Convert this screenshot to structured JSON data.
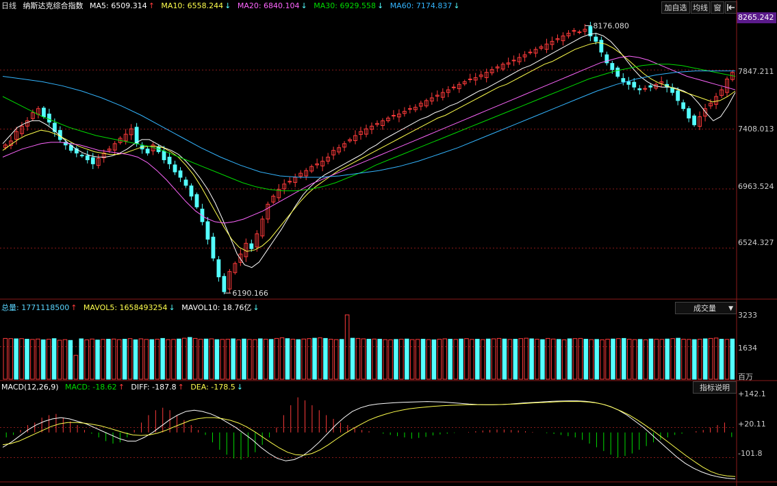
{
  "colors": {
    "up": "#ff3b3b",
    "down": "#54ffff",
    "ma5": "#ffffff",
    "ma10": "#ffff4d",
    "ma20": "#ff66ff",
    "ma30": "#00dd00",
    "ma60": "#33b5ff",
    "grid": "#8b1a1a",
    "axis_box": "#5a1a8a"
  },
  "price_header": {
    "period": "日线",
    "index_name": "纳斯达克综合指数",
    "ma5": "MA5: 6509.314",
    "ma5_arrow": "↑",
    "ma10": "MA10: 6558.244",
    "ma10_arrow": "↓",
    "ma20": "MA20: 6840.104",
    "ma20_arrow": "↓",
    "ma30": "MA30: 6929.558",
    "ma30_arrow": "↓",
    "ma60": "MA60: 7174.837",
    "ma60_arrow": "↓"
  },
  "toolbar": {
    "add_watch": "加自选",
    "avg_line": "均线",
    "window": "窗",
    "exit_icon": "exit-icon"
  },
  "volume_header": {
    "total": "总量: 1771118500",
    "total_arrow": "↑",
    "mavol5": "MAVOL5: 1658493254",
    "mavol5_arrow": "↓",
    "mavol10": "MAVOL10: 18.76亿",
    "mavol10_arrow": "↓",
    "dropdown_label": "成交量",
    "dropdown_icon": "triangle-down-icon"
  },
  "macd_header": {
    "params": "MACD(12,26,9)",
    "macd": "MACD: -18.62",
    "macd_arrow": "↑",
    "diff": "DIFF: -187.8",
    "diff_arrow": "↑",
    "dea": "DEA: -178.5",
    "dea_arrow": "↓",
    "help_button": "指标说明"
  },
  "price_axis": {
    "top_box": "8265.242",
    "labels": [
      "7847.211",
      "7408.013",
      "6963.524",
      "6524.327"
    ]
  },
  "volume_axis": {
    "labels": [
      "3233",
      "1634"
    ],
    "unit": "百万"
  },
  "macd_axis": {
    "labels": [
      "+142.1",
      "+20.11",
      "-101.8"
    ]
  },
  "chart_data": [
    {
      "type": "candlestick",
      "title": "纳斯达克综合指数",
      "annotations": [
        {
          "label": "8176.080",
          "value": 8176.08,
          "kind": "high"
        },
        {
          "label": "6190.166",
          "value": 6190.166,
          "kind": "low"
        }
      ],
      "ylim": [
        6150,
        8265.242
      ],
      "yticks": [
        7847.211,
        7408.013,
        6963.524,
        6524.327
      ],
      "close": [
        7290,
        7320,
        7390,
        7430,
        7470,
        7530,
        7560,
        7500,
        7460,
        7390,
        7330,
        7290,
        7250,
        7230,
        7210,
        7180,
        7150,
        7190,
        7230,
        7260,
        7300,
        7340,
        7370,
        7410,
        7300,
        7260,
        7230,
        7290,
        7240,
        7180,
        7150,
        7090,
        7050,
        6990,
        6910,
        6830,
        6720,
        6590,
        6450,
        6310,
        6200,
        6350,
        6410,
        6480,
        6560,
        6520,
        6630,
        6740,
        6850,
        6910,
        6960,
        7000,
        7020,
        7050,
        7080,
        7100,
        7130,
        7150,
        7170,
        7200,
        7250,
        7270,
        7300,
        7330,
        7360,
        7390,
        7410,
        7430,
        7450,
        7470,
        7490,
        7510,
        7520,
        7540,
        7560,
        7570,
        7600,
        7620,
        7640,
        7660,
        7680,
        7700,
        7720,
        7740,
        7760,
        7780,
        7790,
        7810,
        7830,
        7850,
        7870,
        7890,
        7900,
        7920,
        7940,
        7960,
        7980,
        8000,
        8020,
        8040,
        8060,
        8080,
        8100,
        8120,
        8140,
        8130,
        8150,
        8100,
        8060,
        7980,
        7900,
        7850,
        7800,
        7760,
        7740,
        7720,
        7700,
        7710,
        7720,
        7740,
        7760,
        7720,
        7680,
        7620,
        7560,
        7490,
        7440,
        7500,
        7560,
        7600,
        7650,
        7700,
        7780,
        7830
      ]
    },
    {
      "type": "line",
      "series": [
        {
          "name": "MA5",
          "values": [
            7300,
            7360,
            7420,
            7450,
            7470,
            7470,
            7440,
            7400,
            7350,
            7300,
            7260,
            7230,
            7210,
            7200,
            7200,
            7210,
            7230,
            7260,
            7300,
            7330,
            7330,
            7300,
            7270,
            7250,
            7220,
            7170,
            7110,
            7040,
            6960,
            6860,
            6740,
            6610,
            6480,
            6400,
            6380,
            6420,
            6500,
            6580,
            6660,
            6750,
            6840,
            6920,
            6980,
            7030,
            7070,
            7100,
            7130,
            7160,
            7190,
            7220,
            7260,
            7290,
            7330,
            7360,
            7390,
            7420,
            7450,
            7480,
            7500,
            7530,
            7550,
            7580,
            7600,
            7630,
            7660,
            7690,
            7710,
            7740,
            7770,
            7800,
            7830,
            7860,
            7880,
            7910,
            7940,
            7970,
            8000,
            8030,
            8060,
            8090,
            8110,
            8120,
            8100,
            8060,
            8000,
            7930,
            7860,
            7800,
            7760,
            7730,
            7720,
            7720,
            7710,
            7690,
            7660,
            7600,
            7530,
            7470,
            7500,
            7580,
            7680
          ]
        },
        {
          "name": "MA10",
          "values": [
            7250,
            7290,
            7330,
            7360,
            7380,
            7400,
            7390,
            7370,
            7340,
            7310,
            7280,
            7260,
            7240,
            7230,
            7220,
            7220,
            7230,
            7250,
            7270,
            7280,
            7280,
            7270,
            7240,
            7200,
            7140,
            7070,
            6980,
            6880,
            6780,
            6680,
            6590,
            6530,
            6500,
            6510,
            6540,
            6590,
            6660,
            6730,
            6800,
            6870,
            6930,
            6980,
            7020,
            7060,
            7100,
            7130,
            7160,
            7190,
            7220,
            7250,
            7280,
            7310,
            7340,
            7370,
            7400,
            7430,
            7460,
            7490,
            7510,
            7540,
            7570,
            7600,
            7630,
            7660,
            7690,
            7720,
            7740,
            7770,
            7800,
            7830,
            7860,
            7890,
            7910,
            7940,
            7970,
            8000,
            8020,
            8040,
            8050,
            8040,
            8010,
            7970,
            7920,
            7870,
            7820,
            7780,
            7750,
            7730,
            7710,
            7690,
            7670,
            7650,
            7630,
            7610,
            7620,
            7650,
            7690
          ]
        },
        {
          "name": "MA20",
          "values": [
            7200,
            7230,
            7260,
            7280,
            7300,
            7310,
            7310,
            7300,
            7290,
            7270,
            7250,
            7240,
            7230,
            7220,
            7200,
            7160,
            7100,
            7030,
            6950,
            6870,
            6800,
            6750,
            6720,
            6710,
            6720,
            6740,
            6770,
            6800,
            6840,
            6880,
            6920,
            6960,
            7000,
            7030,
            7060,
            7090,
            7120,
            7150,
            7180,
            7210,
            7240,
            7270,
            7300,
            7330,
            7360,
            7390,
            7420,
            7450,
            7480,
            7510,
            7540,
            7570,
            7600,
            7630,
            7660,
            7690,
            7720,
            7750,
            7780,
            7810,
            7840,
            7870,
            7900,
            7920,
            7940,
            7950,
            7940,
            7920,
            7890,
            7860,
            7830,
            7800,
            7780,
            7760,
            7740,
            7720,
            7700
          ]
        },
        {
          "name": "MA30",
          "values": [
            7650,
            7600,
            7550,
            7500,
            7460,
            7420,
            7390,
            7360,
            7340,
            7320,
            7300,
            7280,
            7250,
            7210,
            7170,
            7130,
            7090,
            7050,
            7010,
            6980,
            6960,
            6950,
            6950,
            6960,
            6980,
            7010,
            7050,
            7090,
            7140,
            7180,
            7220,
            7260,
            7300,
            7340,
            7380,
            7420,
            7460,
            7500,
            7540,
            7580,
            7620,
            7660,
            7700,
            7740,
            7780,
            7810,
            7840,
            7860,
            7880,
            7890,
            7890,
            7880,
            7860,
            7840,
            7820,
            7800
          ]
        },
        {
          "name": "MA60",
          "values": [
            7800,
            7780,
            7760,
            7730,
            7690,
            7640,
            7580,
            7510,
            7430,
            7350,
            7270,
            7200,
            7140,
            7090,
            7060,
            7050,
            7050,
            7060,
            7080,
            7100,
            7130,
            7170,
            7220,
            7270,
            7330,
            7390,
            7450,
            7510,
            7570,
            7630,
            7690,
            7740,
            7780,
            7810,
            7830,
            7840,
            7840,
            7840
          ]
        }
      ]
    },
    {
      "type": "bar",
      "title": "成交量",
      "values": [
        2050,
        2040,
        2030,
        2040,
        2010,
        2000,
        2020,
        1980,
        2010,
        2040,
        1960,
        1990,
        1950,
        1200,
        2030,
        1980,
        2020,
        1970,
        2000,
        2010,
        2020,
        1990,
        2010,
        2040,
        1980,
        2030,
        2000,
        1990,
        2010,
        2050,
        1990,
        2000,
        2020,
        2060,
        2100,
        2050,
        2010,
        2020,
        2030,
        1990,
        2000,
        2010,
        2030,
        1980,
        2020,
        2000,
        1990,
        2030,
        2010,
        2000,
        2050,
        2080,
        2040,
        2010,
        1990,
        2020,
        2040,
        2060,
        2080,
        2050,
        2010,
        1990,
        2000,
        3233,
        2060,
        2050,
        2030,
        2010,
        2020,
        2010,
        1990,
        1980,
        2000,
        2010,
        2020,
        1990,
        2000,
        2010,
        1990,
        1980,
        2010,
        2030,
        2010,
        2000,
        2020,
        2040,
        2000,
        2010,
        1990,
        2020,
        2030,
        2050,
        2020,
        2000,
        2010,
        2040,
        2060,
        2030,
        2010,
        1990,
        2050,
        2020,
        2000,
        1980,
        2030,
        2040,
        2050,
        2010,
        1990,
        2000,
        1980,
        2010,
        2020,
        2040,
        2050,
        2010,
        1990,
        2000,
        1980,
        2020,
        2010,
        2000,
        2020,
        2040,
        2060,
        2010,
        2000,
        1990,
        2010,
        2030,
        2050,
        2070,
        2010,
        2000,
        2020
      ],
      "ylim": [
        0,
        3233
      ],
      "unit": "百万"
    },
    {
      "type": "bar",
      "title": "MACD(12,26,9)",
      "series": [
        {
          "name": "MACD",
          "values": [
            -20,
            -10,
            10,
            30,
            40,
            60,
            70,
            75,
            60,
            45,
            30,
            10,
            -5,
            -20,
            -35,
            -45,
            -40,
            -20,
            10,
            40,
            70,
            90,
            100,
            90,
            70,
            50,
            30,
            10,
            -10,
            -40,
            -70,
            -90,
            -105,
            -110,
            -100,
            -80,
            -50,
            -20,
            20,
            70,
            110,
            142,
            130,
            110,
            90,
            70,
            55,
            40,
            30,
            20,
            10,
            5,
            0,
            -5,
            -10,
            -15,
            -20,
            -25,
            -22,
            -18,
            -12,
            -8,
            -5,
            -2,
            0,
            2,
            5,
            8,
            10,
            12,
            12,
            10,
            8,
            5,
            2,
            0,
            -3,
            -6,
            -10,
            -15,
            -20,
            -30,
            -45,
            -60,
            -75,
            -90,
            -101.8,
            -95,
            -85,
            -70,
            -55,
            -40,
            -30,
            -20,
            -10,
            -5,
            0,
            5,
            10,
            20,
            30,
            40,
            -18.62
          ]
        },
        {
          "name": "DIFF",
          "values": [
            -60,
            -40,
            -15,
            10,
            30,
            45,
            55,
            60,
            55,
            45,
            35,
            20,
            5,
            -10,
            -25,
            -35,
            -35,
            -20,
            0,
            25,
            50,
            70,
            85,
            90,
            85,
            75,
            60,
            40,
            20,
            -5,
            -30,
            -60,
            -85,
            -105,
            -115,
            -110,
            -95,
            -70,
            -40,
            -5,
            30,
            60,
            85,
            100,
            110,
            115,
            118,
            120,
            122,
            123,
            124,
            125,
            124,
            123,
            120,
            118,
            115,
            113,
            112,
            112,
            113,
            115,
            118,
            120,
            122,
            124,
            126,
            127,
            128,
            128,
            126,
            122,
            115,
            105,
            90,
            70,
            45,
            20,
            -10,
            -40,
            -70,
            -100,
            -125,
            -145,
            -160,
            -172,
            -180,
            -185,
            -187.8
          ]
        },
        {
          "name": "DEA",
          "values": [
            -50,
            -45,
            -35,
            -20,
            -5,
            10,
            25,
            35,
            40,
            40,
            38,
            33,
            27,
            18,
            8,
            -2,
            -10,
            -12,
            -10,
            -3,
            8,
            22,
            35,
            48,
            56,
            60,
            60,
            56,
            49,
            38,
            22,
            2,
            -20,
            -42,
            -63,
            -80,
            -90,
            -92,
            -85,
            -70,
            -50,
            -27,
            -5,
            15,
            33,
            50,
            63,
            74,
            83,
            90,
            96,
            100,
            103,
            106,
            108,
            110,
            111,
            112,
            112,
            112,
            112,
            113,
            114,
            115,
            117,
            119,
            121,
            122,
            124,
            125,
            125,
            125,
            123,
            119,
            112,
            100,
            86,
            70,
            50,
            28,
            5,
            -20,
            -45,
            -70,
            -95,
            -118,
            -140,
            -158,
            -170,
            -176,
            -178.5
          ]
        }
      ]
    }
  ]
}
